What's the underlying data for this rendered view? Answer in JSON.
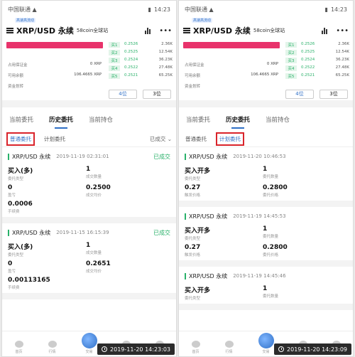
{
  "panels": [
    {
      "status": {
        "carrier": "中国联通 ▲",
        "time": "14:23"
      },
      "header": {
        "tagline": "高速高流动",
        "pair": "XRP/USD 永续",
        "exchange": "58coin全球站",
        "more": "•••"
      },
      "account": {
        "rows": [
          {
            "label": "占用保证金",
            "value": "0 XRP"
          },
          {
            "label": "可用余额",
            "value": "106.4665 XRP"
          },
          {
            "label": "资金划转",
            "value": ""
          }
        ]
      },
      "orderbook": [
        {
          "lvl": "买1",
          "price": "0.2526",
          "amt": "2.36K"
        },
        {
          "lvl": "买2",
          "price": "0.2525",
          "amt": "12.54K"
        },
        {
          "lvl": "买3",
          "price": "0.2524",
          "amt": "36.23K"
        },
        {
          "lvl": "买4",
          "price": "0.2522",
          "amt": "27.48K"
        },
        {
          "lvl": "买5",
          "price": "0.2521",
          "amt": "65.25K"
        }
      ],
      "depth": [
        "4位",
        "3位"
      ],
      "tabs": [
        "当前委托",
        "历史委托",
        "当前持仓"
      ],
      "active_tab": 1,
      "subtabs": [
        "普通委托",
        "计划委托"
      ],
      "selected_subtab": 0,
      "filter": "已成交 ⌄",
      "orders": [
        {
          "name": "XRP/USD 永续",
          "time": "2019-11-19 02:31:01",
          "state": "已成交",
          "cells": [
            {
              "val": "买入(多)",
              "lab": "委托类型"
            },
            {
              "val": "1",
              "lab": "成交数量"
            },
            {
              "val": "0",
              "lab": "盈亏"
            },
            {
              "val": "0.2500",
              "lab": "成交均价"
            },
            {
              "val": "0.0006",
              "lab": "手续费"
            }
          ]
        },
        {
          "name": "XRP/USD 永续",
          "time": "2019-11-15 16:15:39",
          "state": "已成交",
          "cells": [
            {
              "val": "买入(多)",
              "lab": "委托类型"
            },
            {
              "val": "1",
              "lab": "成交数量"
            },
            {
              "val": "0",
              "lab": "盈亏"
            },
            {
              "val": "0.2651",
              "lab": "成交均价"
            },
            {
              "val": "0.00113165",
              "lab": "手续费"
            }
          ]
        }
      ],
      "nav": [
        "首页",
        "行情",
        "交易",
        "资产",
        "我的"
      ],
      "timestamp": "2019-11-20 14:23:03"
    },
    {
      "status": {
        "carrier": "中国联通 ▲",
        "time": "14:23"
      },
      "header": {
        "tagline": "高速高流动",
        "pair": "XRP/USD 永续",
        "exchange": "58coin全球站",
        "more": "•••"
      },
      "account": {
        "rows": [
          {
            "label": "占用保证金",
            "value": "0 XRP"
          },
          {
            "label": "可用余额",
            "value": "106.4665 XRP"
          },
          {
            "label": "资金划转",
            "value": ""
          }
        ]
      },
      "orderbook": [
        {
          "lvl": "买1",
          "price": "0.2526",
          "amt": "2.36K"
        },
        {
          "lvl": "买2",
          "price": "0.2525",
          "amt": "12.54K"
        },
        {
          "lvl": "买3",
          "price": "0.2524",
          "amt": "36.23K"
        },
        {
          "lvl": "买4",
          "price": "0.2522",
          "amt": "27.48K"
        },
        {
          "lvl": "买5",
          "price": "0.2521",
          "amt": "65.25K"
        }
      ],
      "depth": [
        "4位",
        "3位"
      ],
      "tabs": [
        "当前委托",
        "历史委托",
        "当前持仓"
      ],
      "active_tab": 1,
      "subtabs": [
        "普通委托",
        "计划委托"
      ],
      "selected_subtab": 1,
      "filter": "",
      "orders": [
        {
          "name": "XRP/USD 永续",
          "time": "2019-11-20 10:46:53",
          "state": "",
          "cells": [
            {
              "val": "买入开多",
              "lab": "委托类型"
            },
            {
              "val": "1",
              "lab": "委托数量"
            },
            {
              "val": "0.27",
              "lab": "触发价格"
            },
            {
              "val": "0.2800",
              "lab": "委托价格"
            }
          ]
        },
        {
          "name": "XRP/USD 永续",
          "time": "2019-11-19 14:45:53",
          "state": "",
          "cells": [
            {
              "val": "买入开多",
              "lab": "委托类型"
            },
            {
              "val": "1",
              "lab": "委托数量"
            },
            {
              "val": "0.27",
              "lab": "触发价格"
            },
            {
              "val": "0.2800",
              "lab": "委托价格"
            }
          ]
        },
        {
          "name": "XRP/USD 永续",
          "time": "2019-11-19 14:45:46",
          "state": "",
          "cells": [
            {
              "val": "买入开多",
              "lab": "委托类型"
            },
            {
              "val": "1",
              "lab": "委托数量"
            }
          ]
        }
      ],
      "nav": [
        "首页",
        "行情",
        "交易",
        "资产",
        "我的"
      ],
      "timestamp": "2019-11-20 14:23:09"
    }
  ]
}
